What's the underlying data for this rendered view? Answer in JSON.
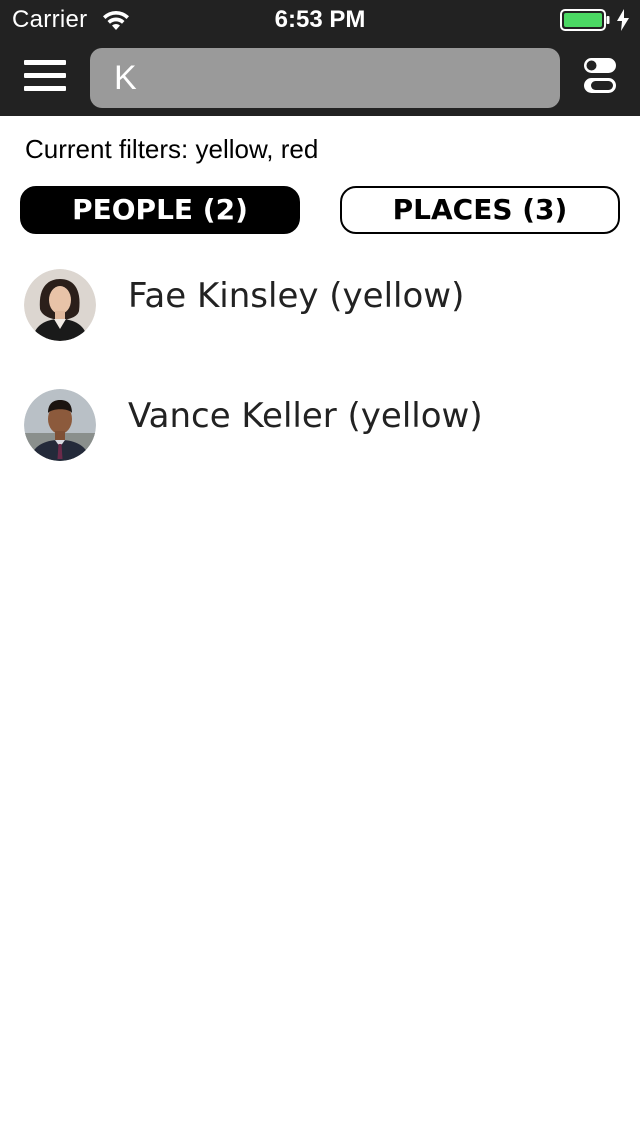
{
  "status_bar": {
    "carrier": "Carrier",
    "time": "6:53 PM",
    "icons": [
      "wifi-icon",
      "battery-icon",
      "charging-icon"
    ],
    "battery_color": "#4cd964"
  },
  "nav": {
    "menu_icon": "hamburger-menu-icon",
    "search_value": "K",
    "filter_icon": "filter-toggle-icon",
    "background": "#222222"
  },
  "filters": {
    "text": "Current filters: yellow, red"
  },
  "tabs": [
    {
      "label": "PEOPLE (2)",
      "active": true
    },
    {
      "label": "PLACES (3)",
      "active": false
    }
  ],
  "people": [
    {
      "name": "Fae Kinsley (yellow)",
      "avatar": "avatar-photo-woman"
    },
    {
      "name": "Vance Keller (yellow)",
      "avatar": "avatar-photo-man"
    }
  ]
}
